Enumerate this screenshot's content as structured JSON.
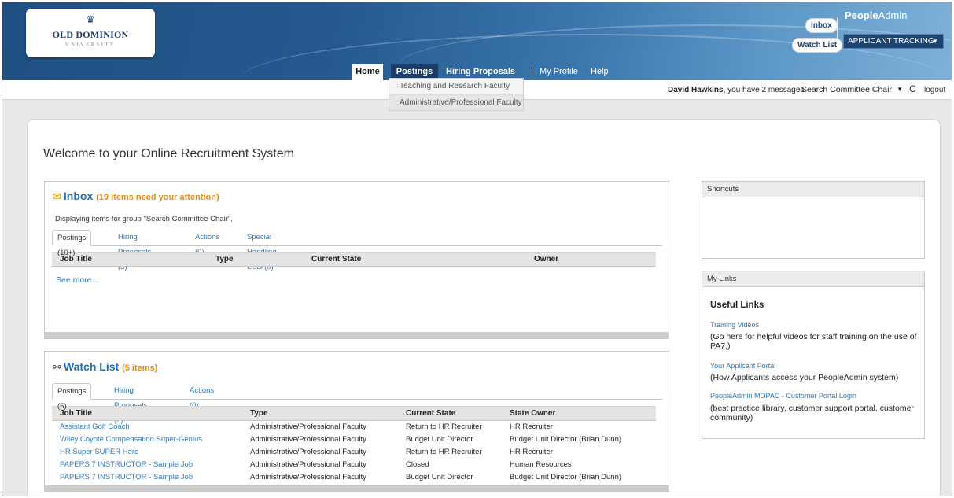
{
  "header": {
    "logo_line1": "OLD DOMINION",
    "logo_line2": "UNIVERSITY",
    "inbox_pill": "Inbox",
    "watchlist_pill": "Watch List",
    "brand_bold": "People",
    "brand_rest": "Admin",
    "app_selector": "APPLICANT TRACKING"
  },
  "nav": {
    "home": "Home",
    "postings": "Postings",
    "hiring_proposals": "Hiring Proposals",
    "separator": "|",
    "my_profile": "My Profile",
    "help": "Help"
  },
  "postings_menu": [
    "Teaching and Research Faculty",
    "Administrative/Professional Faculty"
  ],
  "userbar": {
    "user_name": "David Hawkins",
    "message_text": ", you have 2 messages.",
    "role": "Search Committee Chair",
    "refresh_glyph": "C",
    "logout": "logout"
  },
  "page": {
    "welcome": "Welcome to your Online Recruitment System"
  },
  "inbox": {
    "title": "Inbox",
    "count": "(19 items need your attention)",
    "display_note": "Displaying items for group \"Search Committee Chair\".",
    "tabs": [
      "Postings (10+)",
      "Hiring Proposals (3)",
      "Actions (0)",
      "Special Handling Lists (0)"
    ],
    "columns": [
      "Job Title",
      "Type",
      "Current State",
      "Owner"
    ],
    "see_more": "See more..."
  },
  "watchlist": {
    "title": "Watch List",
    "count": "(5 items)",
    "tabs": [
      "Postings (5)",
      "Hiring Proposals (0)",
      "Actions (0)"
    ],
    "columns": [
      "Job Title",
      "Type",
      "Current State",
      "State Owner"
    ],
    "rows": [
      {
        "title": "Assistant Golf Coach",
        "type": "Administrative/Professional Faculty",
        "state": "Return to HR Recruiter",
        "owner": "HR Recruiter"
      },
      {
        "title": "Wiley Coyote Compensation Super-Genius",
        "type": "Administrative/Professional Faculty",
        "state": "Budget Unit Director",
        "owner": "Budget Unit Director (Brian Dunn)"
      },
      {
        "title": "HR Super SUPER Hero",
        "type": "Administrative/Professional Faculty",
        "state": "Return to HR Recruiter",
        "owner": "HR Recruiter"
      },
      {
        "title": "PAPERS 7 INSTRUCTOR - Sample Job",
        "type": "Administrative/Professional Faculty",
        "state": "Closed",
        "owner": "Human Resources"
      },
      {
        "title": "PAPERS 7 INSTRUCTOR - Sample Job",
        "type": "Administrative/Professional Faculty",
        "state": "Budget Unit Director",
        "owner": "Budget Unit Director (Brian Dunn)"
      }
    ]
  },
  "shortcuts": {
    "title": "Shortcuts"
  },
  "mylinks": {
    "title": "My Links",
    "heading": "Useful Links",
    "links": [
      {
        "label": "Training Videos",
        "desc": "(Go here for helpful videos for staff training on the use of PA7.)"
      },
      {
        "label": "Your Applicant Portal",
        "desc": "(How Applicants access your PeopleAdmin system)"
      },
      {
        "label": "PeopleAdmin MOPAC - Customer Portal Login",
        "desc": " (best practice library, customer support portal, customer community)"
      }
    ]
  }
}
